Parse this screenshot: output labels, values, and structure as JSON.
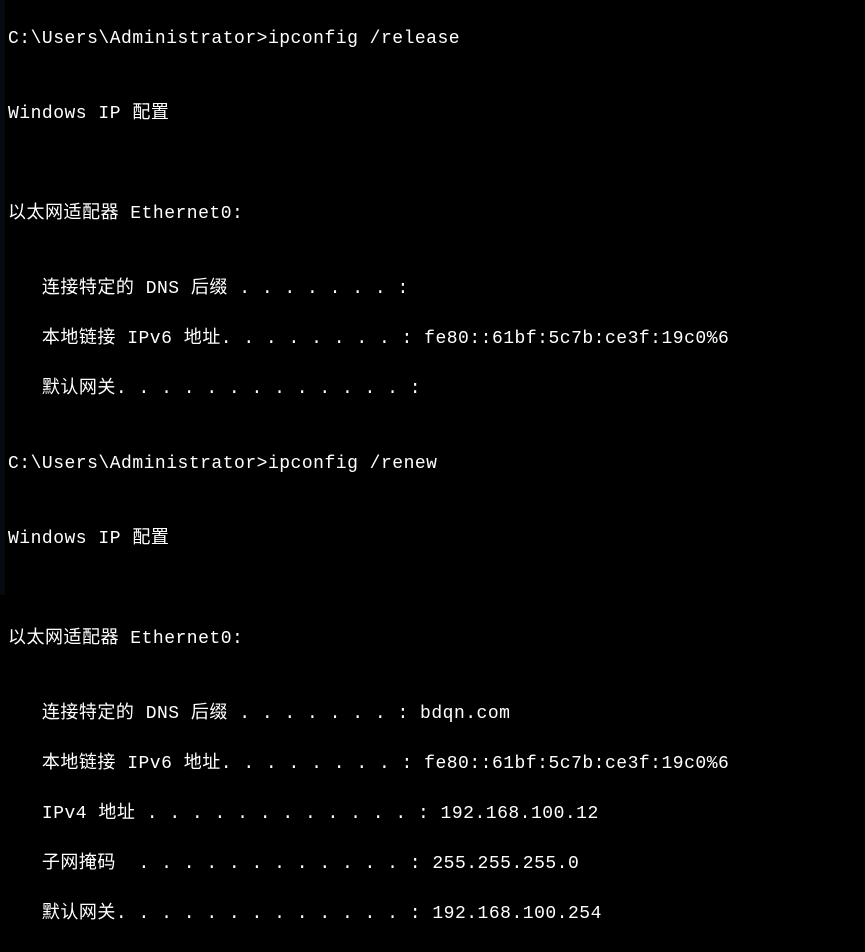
{
  "terminal": {
    "prompt1": "C:\\Users\\Administrator>",
    "cmd1": "ipconfig /release",
    "blank": "",
    "header1": "Windows IP 配置",
    "adapter1_title": "以太网适配器 Ethernet0:",
    "r1_dns_suffix": "   连接特定的 DNS 后缀 . . . . . . . :",
    "r1_ipv6_link": "   本地链接 IPv6 地址. . . . . . . . : fe80::61bf:5c7b:ce3f:19c0%6",
    "r1_gateway": "   默认网关. . . . . . . . . . . . . :",
    "prompt2": "C:\\Users\\Administrator>",
    "cmd2": "ipconfig /renew",
    "header2": "Windows IP 配置",
    "adapter2_title": "以太网适配器 Ethernet0:",
    "r2_dns_suffix": "   连接特定的 DNS 后缀 . . . . . . . : bdqn.com",
    "r2_ipv6_link": "   本地链接 IPv6 地址. . . . . . . . : fe80::61bf:5c7b:ce3f:19c0%6",
    "r2_ipv4": "   IPv4 地址 . . . . . . . . . . . . : 192.168.100.12",
    "r2_subnet": "   子网掩码  . . . . . . . . . . . . : 255.255.255.0",
    "r2_gateway": "   默认网关. . . . . . . . . . . . . : 192.168.100.254"
  }
}
